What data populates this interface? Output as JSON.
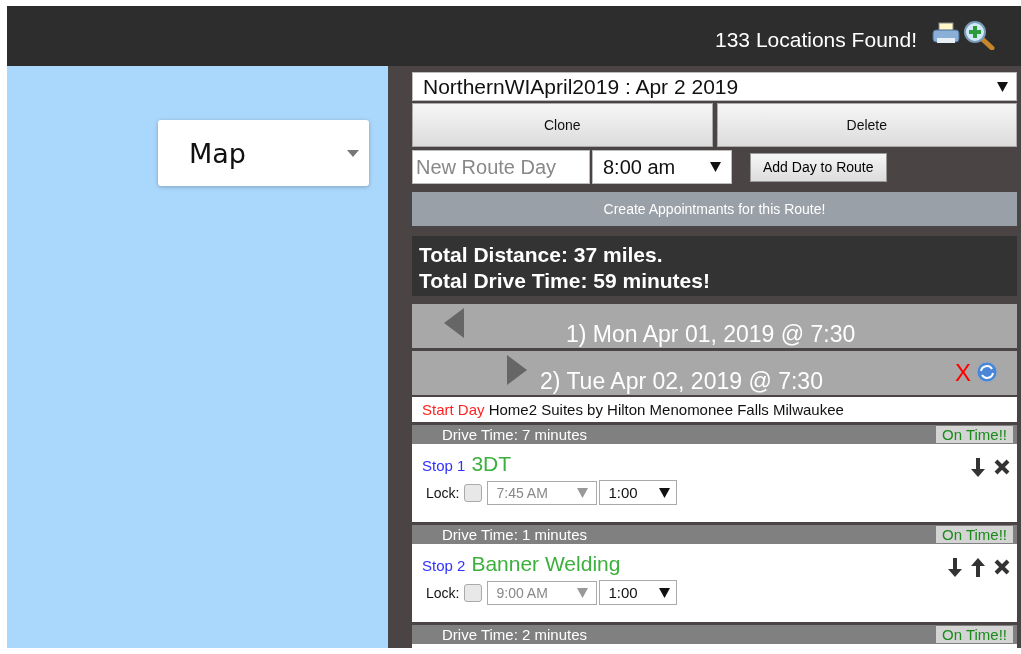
{
  "header": {
    "locations": "133 Locations Found!"
  },
  "map": {
    "type_select": "Map"
  },
  "route": {
    "select": "NorthernWIApril2019 : Apr 2 2019",
    "buttons": [
      "Clone",
      "Delete"
    ],
    "new_day": {
      "placeholder": "New Route Day"
    },
    "time_select": "8:00 am",
    "add_button": "Add Day to Route",
    "create_button": "Create Appointmants for this Route!"
  },
  "totals": [
    "Total Distance: 37 miles.",
    "Total Drive Time: 59 minutes!"
  ],
  "days": [
    {
      "label": "1) Mon Apr 01, 2019 @ 7:30",
      "expanded": false
    },
    {
      "label": "2) Tue Apr 02, 2019 @ 7:30",
      "expanded": true,
      "delete": "X"
    }
  ],
  "start": {
    "label": "Start Day",
    "place": "Home2 Suites by Hilton Menomonee Falls Milwaukee"
  },
  "stops": [
    {
      "drive_time": "Drive Time: 7 minutes",
      "status": "On Time!!",
      "label": "Stop 1",
      "name": "3DT",
      "lock_label": "Lock:",
      "locked": false,
      "time": "7:45 AM",
      "duration": "1:00",
      "can_move_up": false,
      "can_move_down": true
    },
    {
      "drive_time": "Drive Time: 1 minutes",
      "status": "On Time!!",
      "label": "Stop 2",
      "name": "Banner Welding",
      "lock_label": "Lock:",
      "locked": false,
      "time": "9:00 AM",
      "duration": "1:00",
      "can_move_up": true,
      "can_move_down": true
    }
  ],
  "trailing_drive": {
    "drive_time": "Drive Time: 2 minutes",
    "status": "On Time!!"
  }
}
